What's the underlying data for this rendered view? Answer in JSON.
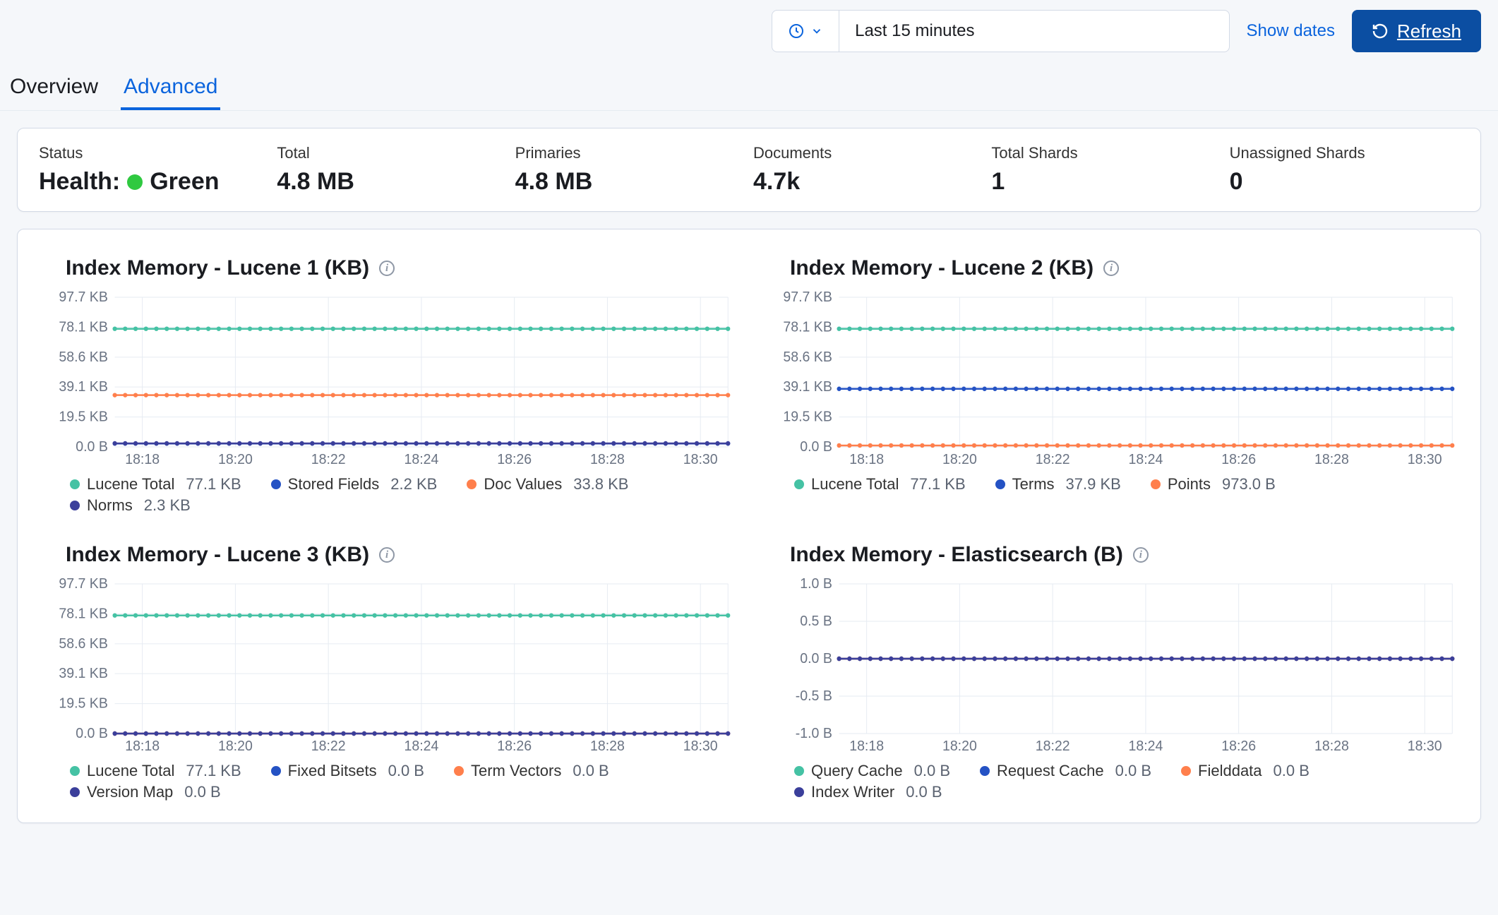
{
  "topbar": {
    "timerange": "Last 15 minutes",
    "show_dates": "Show dates",
    "refresh": "Refresh"
  },
  "tabs": {
    "overview": "Overview",
    "advanced": "Advanced"
  },
  "summary": {
    "status_label": "Status",
    "health_prefix": "Health:",
    "health_value": "Green",
    "total_label": "Total",
    "total_value": "4.8 MB",
    "primaries_label": "Primaries",
    "primaries_value": "4.8 MB",
    "documents_label": "Documents",
    "documents_value": "4.7k",
    "total_shards_label": "Total Shards",
    "total_shards_value": "1",
    "unassigned_label": "Unassigned Shards",
    "unassigned_value": "0"
  },
  "chart_titles": {
    "c1": "Index Memory - Lucene 1 (KB)",
    "c2": "Index Memory - Lucene 2 (KB)",
    "c3": "Index Memory - Lucene 3 (KB)",
    "c4": "Index Memory - Elasticsearch (B)"
  },
  "chart_data": [
    {
      "id": "c1",
      "type": "line",
      "title": "Index Memory - Lucene 1 (KB)",
      "ylabel": "",
      "xlabel": "",
      "y_ticks": [
        "0.0 B",
        "19.5 KB",
        "39.1 KB",
        "58.6 KB",
        "78.1 KB",
        "97.7 KB"
      ],
      "y_values": [
        0,
        19.5,
        39.1,
        58.6,
        78.1,
        97.7
      ],
      "x_ticks": [
        "18:18",
        "18:20",
        "18:22",
        "18:24",
        "18:26",
        "18:28",
        "18:30"
      ],
      "x_values": [
        0,
        1,
        2,
        3,
        4,
        5,
        6
      ],
      "series": [
        {
          "name": "Lucene Total",
          "color": "#45c2a4",
          "value_label": "77.1 KB",
          "constant": 77.1
        },
        {
          "name": "Stored Fields",
          "color": "#2452c4",
          "value_label": "2.2 KB",
          "constant": 2.2
        },
        {
          "name": "Doc Values",
          "color": "#ff7f4c",
          "value_label": "33.8 KB",
          "constant": 33.8
        },
        {
          "name": "Norms",
          "color": "#3b3f9b",
          "value_label": "2.3 KB",
          "constant": 2.3
        }
      ],
      "ylim": [
        0,
        97.7
      ]
    },
    {
      "id": "c2",
      "type": "line",
      "title": "Index Memory - Lucene 2 (KB)",
      "y_ticks": [
        "0.0 B",
        "19.5 KB",
        "39.1 KB",
        "58.6 KB",
        "78.1 KB",
        "97.7 KB"
      ],
      "y_values": [
        0,
        19.5,
        39.1,
        58.6,
        78.1,
        97.7
      ],
      "x_ticks": [
        "18:18",
        "18:20",
        "18:22",
        "18:24",
        "18:26",
        "18:28",
        "18:30"
      ],
      "x_values": [
        0,
        1,
        2,
        3,
        4,
        5,
        6
      ],
      "series": [
        {
          "name": "Lucene Total",
          "color": "#45c2a4",
          "value_label": "77.1 KB",
          "constant": 77.1
        },
        {
          "name": "Terms",
          "color": "#2452c4",
          "value_label": "37.9 KB",
          "constant": 37.9
        },
        {
          "name": "Points",
          "color": "#ff7f4c",
          "value_label": "973.0 B",
          "constant": 0.95
        }
      ],
      "ylim": [
        0,
        97.7
      ]
    },
    {
      "id": "c3",
      "type": "line",
      "title": "Index Memory - Lucene 3 (KB)",
      "y_ticks": [
        "0.0 B",
        "19.5 KB",
        "39.1 KB",
        "58.6 KB",
        "78.1 KB",
        "97.7 KB"
      ],
      "y_values": [
        0,
        19.5,
        39.1,
        58.6,
        78.1,
        97.7
      ],
      "x_ticks": [
        "18:18",
        "18:20",
        "18:22",
        "18:24",
        "18:26",
        "18:28",
        "18:30"
      ],
      "x_values": [
        0,
        1,
        2,
        3,
        4,
        5,
        6
      ],
      "series": [
        {
          "name": "Lucene Total",
          "color": "#45c2a4",
          "value_label": "77.1 KB",
          "constant": 77.1
        },
        {
          "name": "Fixed Bitsets",
          "color": "#2452c4",
          "value_label": "0.0 B",
          "constant": 0
        },
        {
          "name": "Term Vectors",
          "color": "#ff7f4c",
          "value_label": "0.0 B",
          "constant": 0
        },
        {
          "name": "Version Map",
          "color": "#3b3f9b",
          "value_label": "0.0 B",
          "constant": 0
        }
      ],
      "ylim": [
        0,
        97.7
      ]
    },
    {
      "id": "c4",
      "type": "line",
      "title": "Index Memory - Elasticsearch (B)",
      "y_ticks": [
        "-1.0 B",
        "-0.5 B",
        "0.0 B",
        "0.5 B",
        "1.0 B"
      ],
      "y_values": [
        -1,
        -0.5,
        0,
        0.5,
        1
      ],
      "x_ticks": [
        "18:18",
        "18:20",
        "18:22",
        "18:24",
        "18:26",
        "18:28",
        "18:30"
      ],
      "x_values": [
        0,
        1,
        2,
        3,
        4,
        5,
        6
      ],
      "series": [
        {
          "name": "Query Cache",
          "color": "#45c2a4",
          "value_label": "0.0 B",
          "constant": 0
        },
        {
          "name": "Request Cache",
          "color": "#2452c4",
          "value_label": "0.0 B",
          "constant": 0
        },
        {
          "name": "Fielddata",
          "color": "#ff7f4c",
          "value_label": "0.0 B",
          "constant": 0
        },
        {
          "name": "Index Writer",
          "color": "#3b3f9b",
          "value_label": "0.0 B",
          "constant": 0
        }
      ],
      "ylim": [
        -1,
        1
      ]
    }
  ]
}
